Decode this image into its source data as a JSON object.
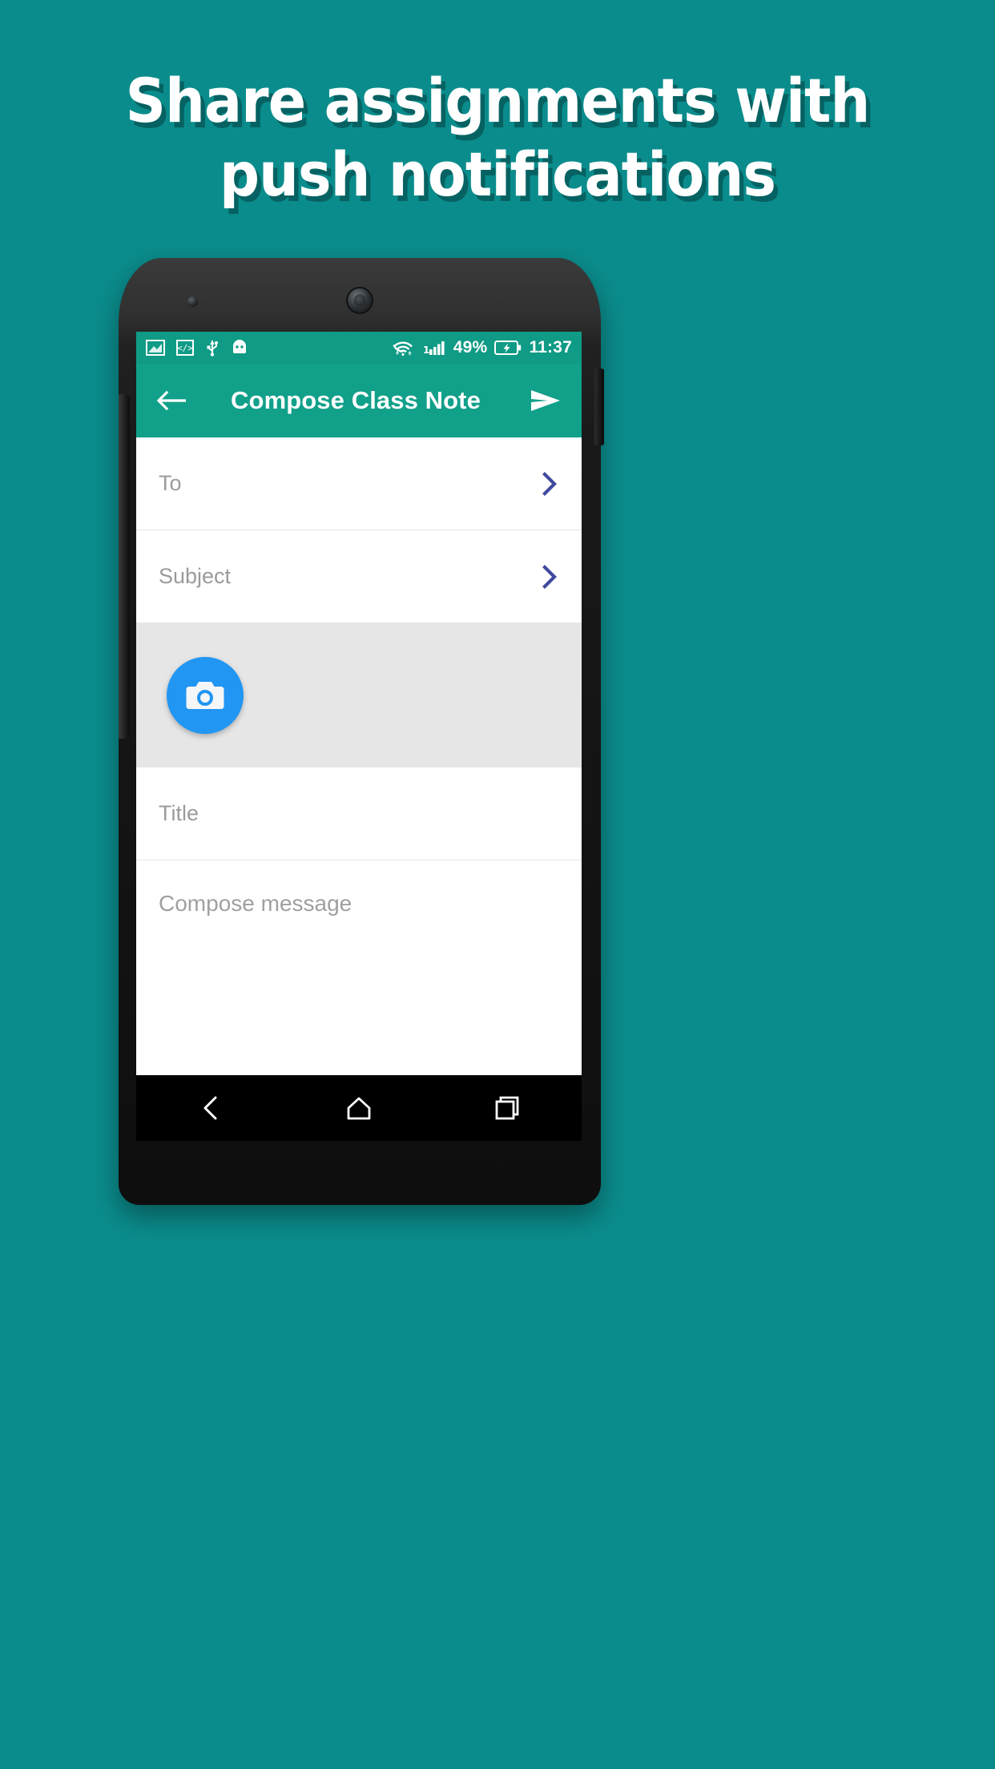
{
  "promo": {
    "headline_line1": "Share assignments with",
    "headline_line2": "push notifications",
    "background_color": "#0b8c8c",
    "headline_color": "#ffffff"
  },
  "phone": {
    "status_bar": {
      "background_color": "#0f9b85",
      "left_icons": [
        "screenshot-icon",
        "developer-code-icon",
        "usb-icon",
        "android-head-icon"
      ],
      "wifi_icon": "wifi-icon",
      "signal_icon": "signal-bars-icon",
      "battery_percent": "49%",
      "battery_icon": "battery-charging-icon",
      "clock": "11:37"
    },
    "app_bar": {
      "background_color": "#11a08a",
      "back_icon": "arrow-back-icon",
      "title": "Compose Class Note",
      "send_icon": "send-icon"
    },
    "form": {
      "accent_chevron_color": "#3f4a9e",
      "rows": [
        {
          "label": "To",
          "chevron": "chevron-right-icon"
        },
        {
          "label": "Subject",
          "chevron": "chevron-right-icon"
        }
      ],
      "photo_band": {
        "background_color": "#e6e6e6",
        "camera_button_color": "#2196f3",
        "camera_icon": "camera-icon"
      },
      "title_placeholder": "Title",
      "message_placeholder": "Compose message"
    },
    "nav_bar": {
      "background_color": "#000000",
      "buttons": [
        "back-nav-icon",
        "home-nav-icon",
        "recents-nav-icon"
      ]
    }
  }
}
